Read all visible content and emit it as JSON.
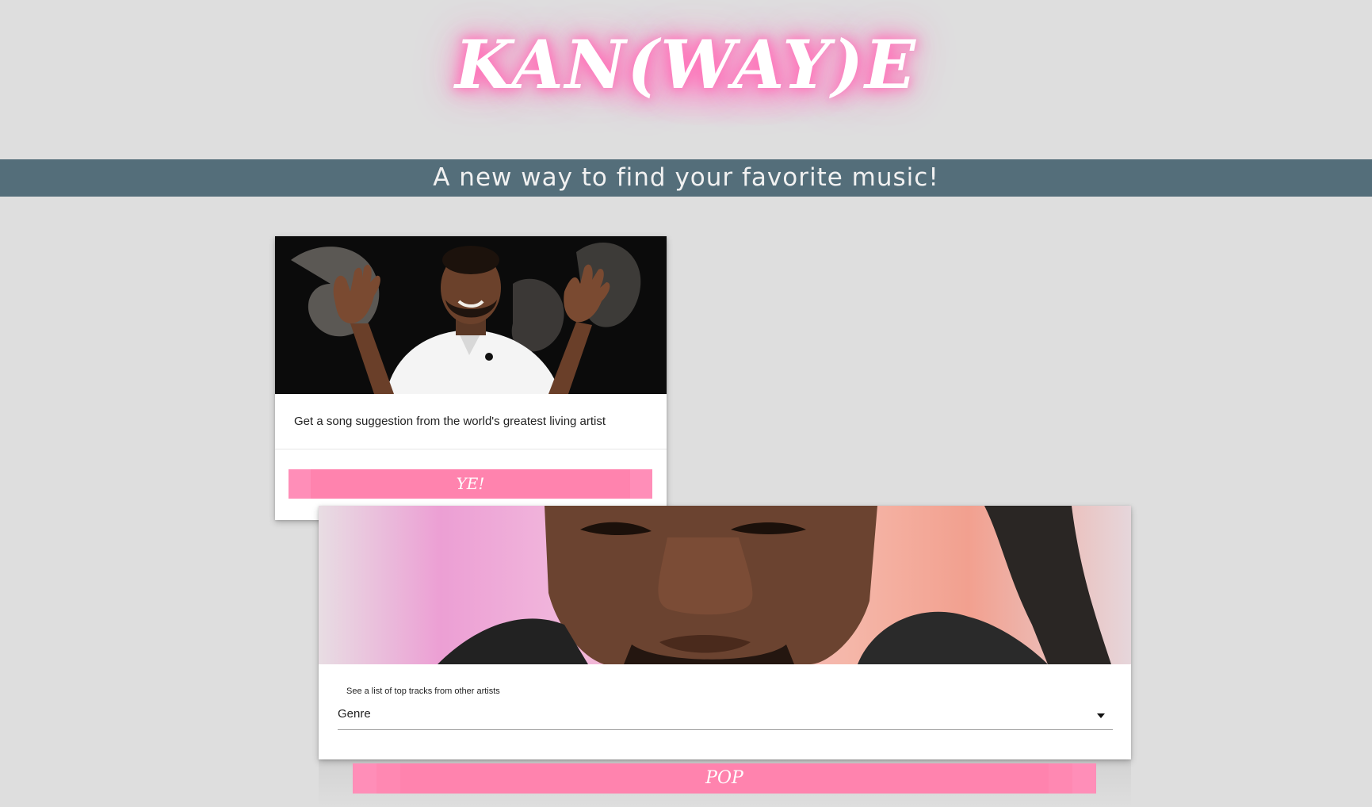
{
  "header": {
    "logo_text": "KAN(WAY)E",
    "tagline": "A new way to find your favorite music!"
  },
  "colors": {
    "background": "#dedede",
    "banner": "#546e7a",
    "accent_pink": "#ff83ae",
    "logo_glow": "#ff7fc0"
  },
  "suggestion_card": {
    "image_alt": "kanye-shrugging-photo",
    "text": "Get a song suggestion from the world's greatest living artist",
    "button_label": "YE!"
  },
  "top_tracks_card": {
    "image_alt": "kanye-closeup-photo",
    "caption": "See a list of top tracks from other artists",
    "genre_select": {
      "selected": "Genre"
    },
    "button_label": "POP"
  }
}
